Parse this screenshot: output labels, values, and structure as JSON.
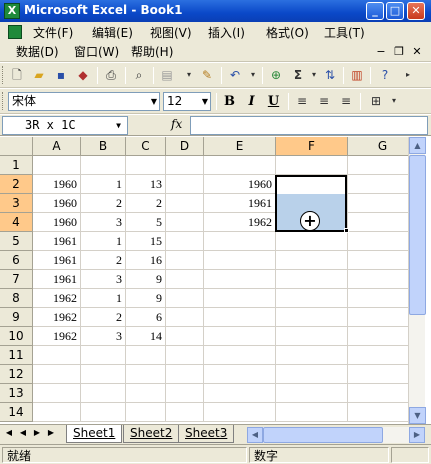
{
  "window": {
    "title": "Microsoft Excel - Book1",
    "app_icon": "X"
  },
  "menu": {
    "items": [
      "文件(F)",
      "编辑(E)",
      "视图(V)",
      "插入(I)",
      "格式(O)",
      "工具(T)",
      "数据(D)",
      "窗口(W)",
      "帮助(H)"
    ]
  },
  "format_toolbar": {
    "font": "宋体",
    "size": "12",
    "bold": "B",
    "italic": "I",
    "underline": "U"
  },
  "formula_bar": {
    "name_box": "3R x 1C",
    "fx": "fx",
    "value": ""
  },
  "grid": {
    "columns": [
      "A",
      "B",
      "C",
      "D",
      "E",
      "F",
      "G"
    ],
    "rows": [
      "1",
      "2",
      "3",
      "4",
      "5",
      "6",
      "7",
      "8",
      "9",
      "10",
      "11",
      "12",
      "13",
      "14"
    ],
    "data": {
      "A": [
        "",
        "1960",
        "1960",
        "1960",
        "1961",
        "1961",
        "1961",
        "1962",
        "1962",
        "1962"
      ],
      "B": [
        "",
        "1",
        "2",
        "3",
        "1",
        "2",
        "3",
        "1",
        "2",
        "3"
      ],
      "C": [
        "",
        "13",
        "2",
        "5",
        "15",
        "16",
        "9",
        "9",
        "6",
        "14"
      ],
      "E": [
        "",
        "1960",
        "1961",
        "1962"
      ]
    },
    "selected_column": "F",
    "selected_rows": [
      "2",
      "3",
      "4"
    ]
  },
  "sheets": [
    "Sheet1",
    "Sheet2",
    "Sheet3"
  ],
  "active_sheet": "Sheet1",
  "status": {
    "mode": "就绪",
    "indicator": "数字"
  }
}
